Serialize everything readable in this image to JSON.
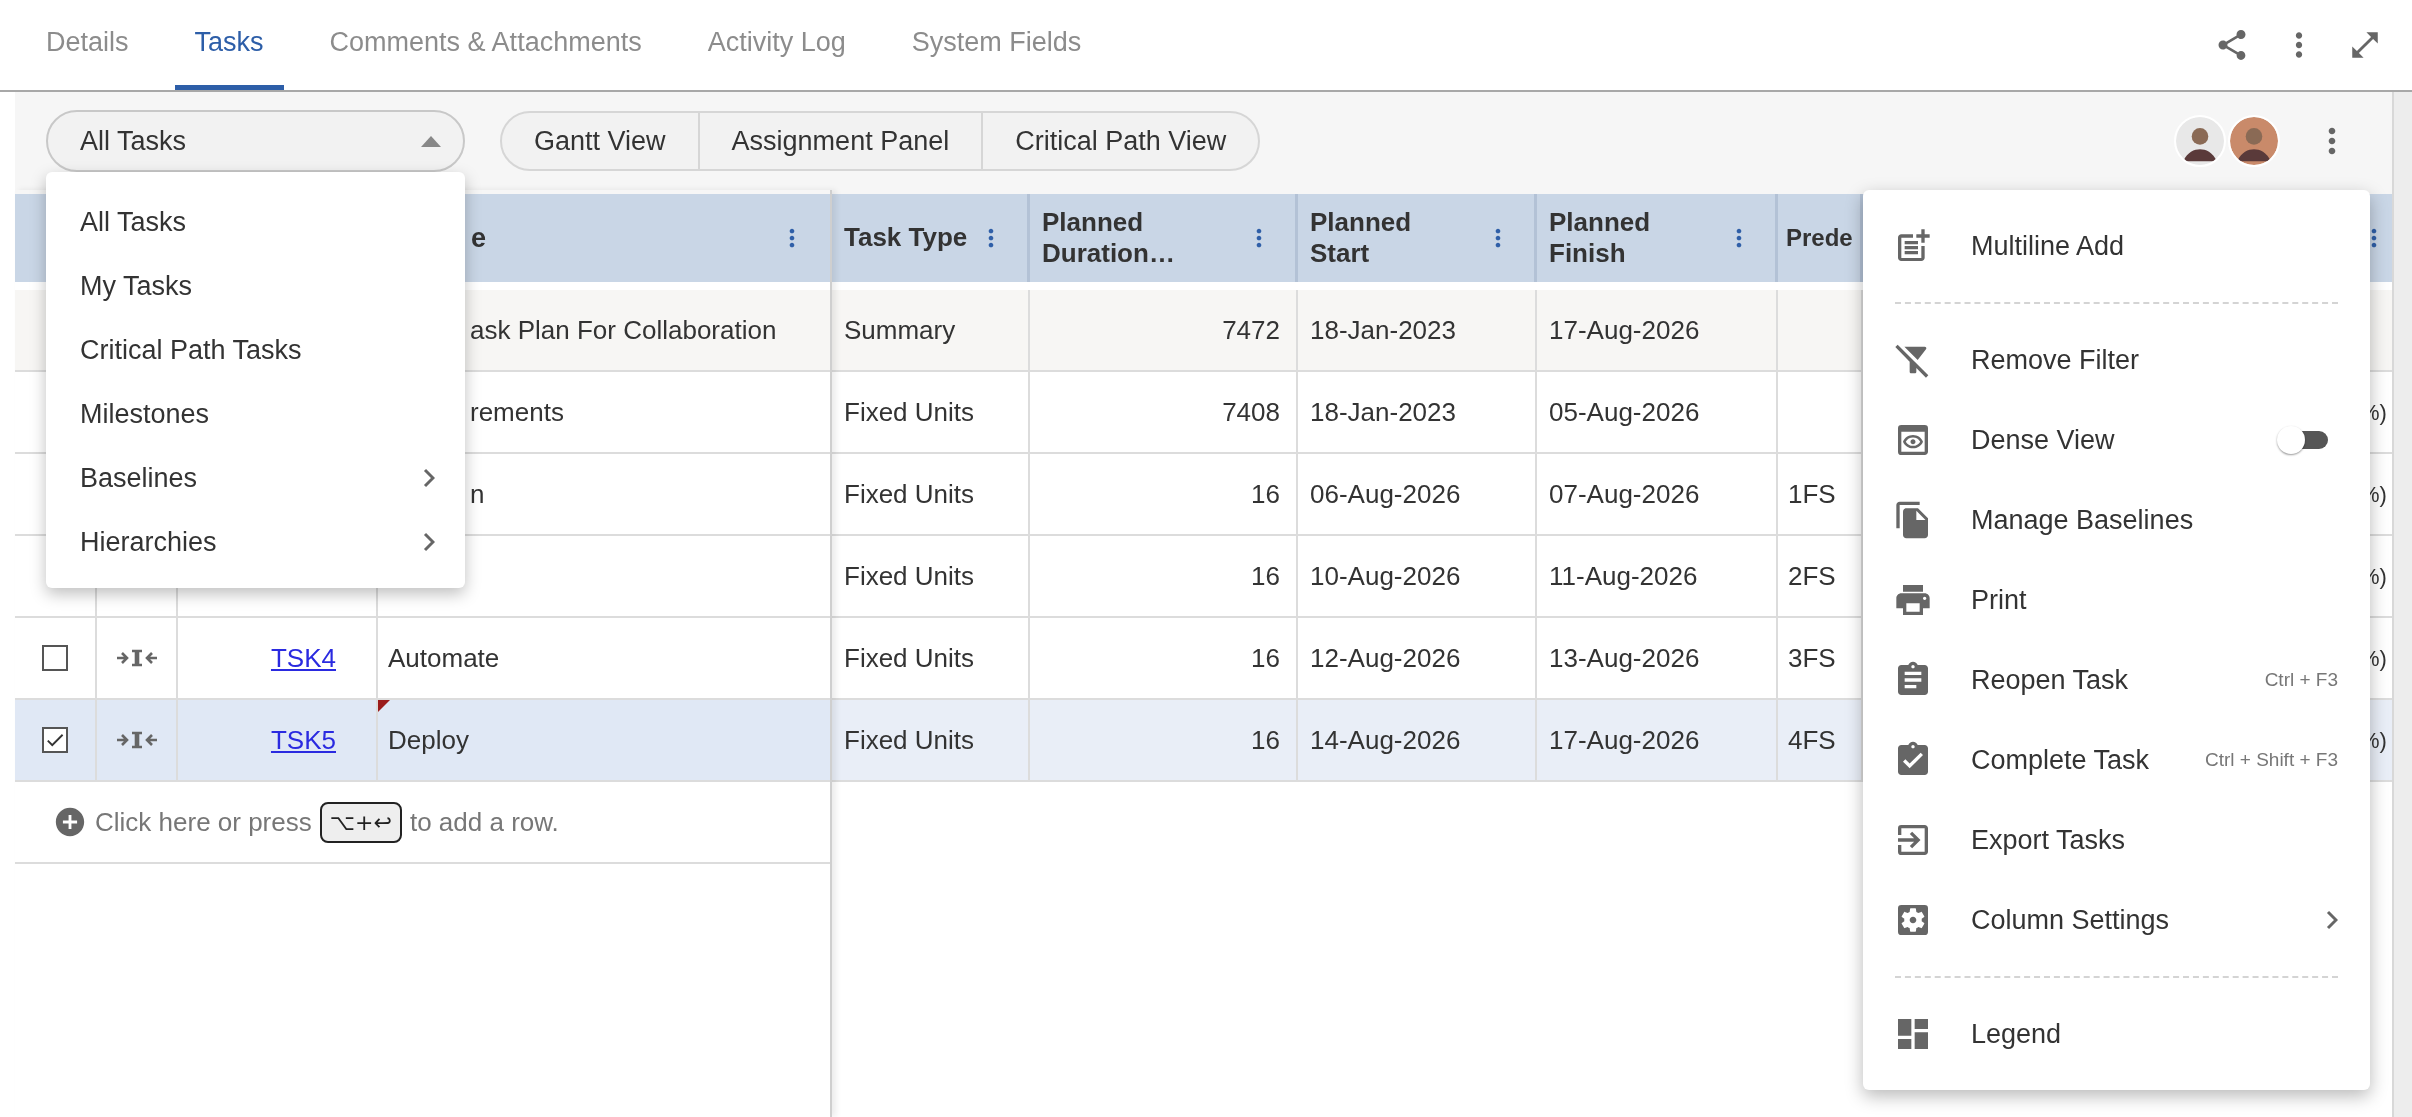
{
  "tabs": [
    {
      "label": "Details",
      "selected": false
    },
    {
      "label": "Tasks",
      "selected": true
    },
    {
      "label": "Comments & Attachments",
      "selected": false
    },
    {
      "label": "Activity Log",
      "selected": false
    },
    {
      "label": "System Fields",
      "selected": false
    }
  ],
  "filter": {
    "value": "All Tasks",
    "expanded": true
  },
  "view_buttons": [
    "Gantt View",
    "Assignment Panel",
    "Critical Path View"
  ],
  "filter_menu": [
    {
      "kind": "option",
      "label": "All Tasks"
    },
    {
      "kind": "option",
      "label": "My Tasks"
    },
    {
      "kind": "option",
      "label": "Critical Path Tasks"
    },
    {
      "kind": "option",
      "label": "Milestones"
    },
    {
      "kind": "submenu",
      "label": "Baselines"
    },
    {
      "kind": "submenu",
      "label": "Hierarchies"
    }
  ],
  "table": {
    "name_column": "e",
    "columns": [
      "Task Type",
      "Planned Duration…",
      "Planned Start",
      "Planned Finish",
      "Prede"
    ],
    "rows": [
      {
        "kind": "summary",
        "selected": false,
        "name": "ask Plan For Collaboration",
        "task_type": "Summary",
        "duration": "7472",
        "start": "18-Jan-2023",
        "finish": "17-Aug-2026"
      },
      {
        "kind": "task",
        "selected": false,
        "name": "rements",
        "task_type": "Fixed Units",
        "duration": "7408",
        "start": "18-Jan-2023",
        "finish": "05-Aug-2026",
        "column_6": "%)"
      },
      {
        "kind": "task",
        "selected": false,
        "name": "n",
        "task_type": "Fixed Units",
        "duration": "16",
        "start": "06-Aug-2026",
        "finish": "07-Aug-2026",
        "predecessor": "1FS",
        "column_6": "%)"
      },
      {
        "kind": "task",
        "selected": false,
        "task_type": "Fixed Units",
        "duration": "16",
        "start": "10-Aug-2026",
        "finish": "11-Aug-2026",
        "predecessor": "2FS",
        "column_6": "%)"
      },
      {
        "kind": "task",
        "selected": false,
        "note": false,
        "checked": false,
        "id": "TSK4",
        "name": "Automate",
        "task_type": "Fixed Units",
        "duration": "16",
        "start": "12-Aug-2026",
        "finish": "13-Aug-2026",
        "predecessor": "3FS",
        "column_6": "%)"
      },
      {
        "kind": "task",
        "selected": true,
        "note": true,
        "checked": true,
        "id": "TSK5",
        "name": "Deploy",
        "task_type": "Fixed Units",
        "duration": "16",
        "start": "14-Aug-2026",
        "finish": "17-Aug-2026",
        "predecessor": "4FS",
        "column_6": "%)"
      }
    ]
  },
  "add_row": {
    "before": "Click here or press",
    "keys": "⌥+↩",
    "after": "to add a row."
  },
  "actions_menu": [
    {
      "kind": "action",
      "label": "Multiline Add",
      "divider_after": true
    },
    {
      "kind": "action",
      "label": "Remove Filter",
      "divider_after": false
    },
    {
      "kind": "toggle",
      "label": "Dense View",
      "on": false,
      "divider_after": false
    },
    {
      "kind": "action",
      "label": "Manage Baselines",
      "divider_after": false
    },
    {
      "kind": "action",
      "label": "Print",
      "divider_after": false
    },
    {
      "kind": "action",
      "label": "Reopen Task",
      "shortcut": "Ctrl + F3",
      "divider_after": false
    },
    {
      "kind": "action",
      "label": "Complete Task",
      "shortcut": "Ctrl + Shift + F3",
      "divider_after": false
    },
    {
      "kind": "action",
      "label": "Export Tasks",
      "divider_after": false
    },
    {
      "kind": "submenu",
      "label": "Column Settings",
      "divider_after": true
    },
    {
      "kind": "action",
      "label": "Legend",
      "divider_after": false
    }
  ]
}
